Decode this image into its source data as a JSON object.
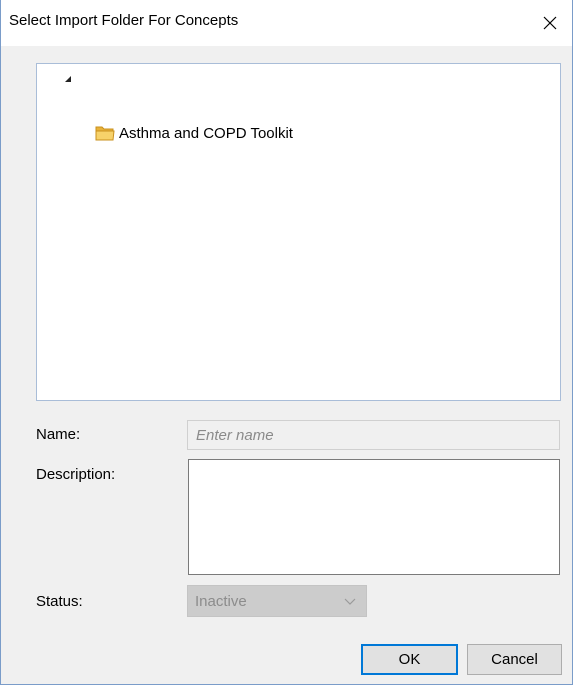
{
  "window": {
    "title": "Select Import Folder For Concepts",
    "close_icon": "close-icon"
  },
  "tree": {
    "expander_icon": "expanded-triangle-icon",
    "nodes": [
      {
        "label": "Asthma and COPD Toolkit",
        "icon": "folder-icon"
      }
    ]
  },
  "form": {
    "name_label": "Name:",
    "name_placeholder": "Enter name",
    "name_value": "",
    "description_label": "Description:",
    "description_value": "",
    "status_label": "Status:",
    "status_value": "Inactive"
  },
  "buttons": {
    "ok_label": "OK",
    "cancel_label": "Cancel"
  },
  "colors": {
    "accent": "#0078d7",
    "folder": "#f4c542",
    "window_bg": "#f0f0f0"
  }
}
